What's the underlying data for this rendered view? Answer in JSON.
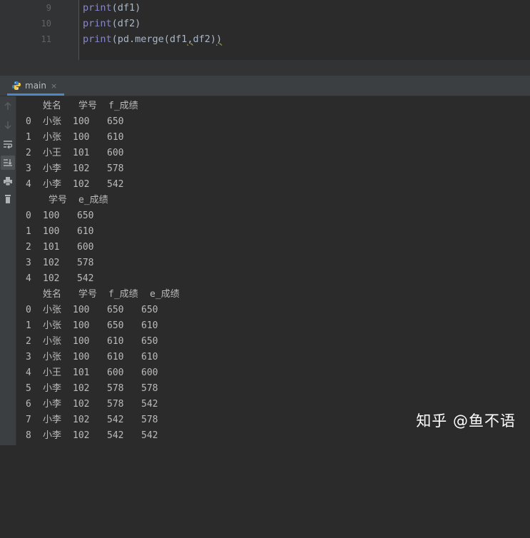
{
  "editor": {
    "lines": [
      {
        "num": "9",
        "text": "print(df1)"
      },
      {
        "num": "10",
        "text": "print(df2)"
      },
      {
        "num": "11",
        "text": "print(pd.merge(df1,df2))"
      }
    ]
  },
  "run_tab": {
    "label": "main",
    "close": "×"
  },
  "toolbar": {
    "icons": [
      "up-arrow-icon",
      "down-arrow-icon",
      "soft-wrap-icon",
      "scroll-to-end-icon",
      "print-icon",
      "trash-icon"
    ]
  },
  "console": {
    "df1": {
      "header": [
        "姓名",
        "学号",
        "f_成绩"
      ],
      "rows": [
        [
          "0",
          "小张",
          "100",
          "650"
        ],
        [
          "1",
          "小张",
          "100",
          "610"
        ],
        [
          "2",
          "小王",
          "101",
          "600"
        ],
        [
          "3",
          "小李",
          "102",
          "578"
        ],
        [
          "4",
          "小李",
          "102",
          "542"
        ]
      ]
    },
    "df2": {
      "header": [
        "学号",
        "e_成绩"
      ],
      "rows": [
        [
          "0",
          "100",
          "650"
        ],
        [
          "1",
          "100",
          "610"
        ],
        [
          "2",
          "101",
          "600"
        ],
        [
          "3",
          "102",
          "578"
        ],
        [
          "4",
          "102",
          "542"
        ]
      ]
    },
    "merged": {
      "header": [
        "姓名",
        "学号",
        "f_成绩",
        "e_成绩"
      ],
      "rows": [
        [
          "0",
          "小张",
          "100",
          "650",
          "650"
        ],
        [
          "1",
          "小张",
          "100",
          "650",
          "610"
        ],
        [
          "2",
          "小张",
          "100",
          "610",
          "650"
        ],
        [
          "3",
          "小张",
          "100",
          "610",
          "610"
        ],
        [
          "4",
          "小王",
          "101",
          "600",
          "600"
        ],
        [
          "5",
          "小李",
          "102",
          "578",
          "578"
        ],
        [
          "6",
          "小李",
          "102",
          "578",
          "542"
        ],
        [
          "7",
          "小李",
          "102",
          "542",
          "578"
        ],
        [
          "8",
          "小李",
          "102",
          "542",
          "542"
        ]
      ]
    }
  },
  "watermark": "知乎 @鱼不语"
}
